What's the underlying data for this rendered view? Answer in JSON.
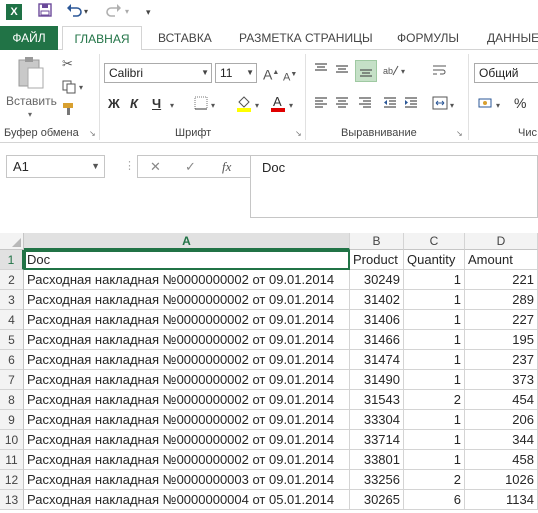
{
  "qat": {
    "logo": "X",
    "save_icon": "save-icon",
    "undo_icon": "undo-icon",
    "redo_icon": "redo-icon",
    "customize_icon": "customize-icon"
  },
  "tabs": [
    "ФАЙЛ",
    "ГЛАВНАЯ",
    "ВСТАВКА",
    "РАЗМЕТКА СТРАНИЦЫ",
    "ФОРМУЛЫ",
    "ДАННЫЕ"
  ],
  "ribbon": {
    "clipboard": {
      "paste_label": "Вставить",
      "group_label": "Буфер обмена"
    },
    "font": {
      "font_name": "Calibri",
      "font_size": "11",
      "bold": "Ж",
      "italic": "К",
      "underline": "Ч",
      "group_label": "Шрифт"
    },
    "alignment": {
      "group_label": "Выравнивание"
    },
    "number": {
      "format": "Общий",
      "percent": "%",
      "group_label": "Чис"
    }
  },
  "formula_bar": {
    "name_box": "A1",
    "cancel": "✕",
    "enter": "✓",
    "fx": "fx",
    "value": "Doc"
  },
  "grid": {
    "columns": [
      "A",
      "B",
      "C",
      "D"
    ],
    "rows": [
      [
        "Doc",
        "Product",
        "Quantity",
        "Amount"
      ],
      [
        "Расходная накладная №0000000002 от 09.01.2014",
        "30249",
        "1",
        "221"
      ],
      [
        "Расходная накладная №0000000002 от 09.01.2014",
        "31402",
        "1",
        "289"
      ],
      [
        "Расходная накладная №0000000002 от 09.01.2014",
        "31406",
        "1",
        "227"
      ],
      [
        "Расходная накладная №0000000002 от 09.01.2014",
        "31466",
        "1",
        "195"
      ],
      [
        "Расходная накладная №0000000002 от 09.01.2014",
        "31474",
        "1",
        "237"
      ],
      [
        "Расходная накладная №0000000002 от 09.01.2014",
        "31490",
        "1",
        "373"
      ],
      [
        "Расходная накладная №0000000002 от 09.01.2014",
        "31543",
        "2",
        "454"
      ],
      [
        "Расходная накладная №0000000002 от 09.01.2014",
        "33304",
        "1",
        "206"
      ],
      [
        "Расходная накладная №0000000002 от 09.01.2014",
        "33714",
        "1",
        "344"
      ],
      [
        "Расходная накладная №0000000002 от 09.01.2014",
        "33801",
        "1",
        "458"
      ],
      [
        "Расходная накладная №0000000003 от 09.01.2014",
        "33256",
        "2",
        "1026"
      ],
      [
        "Расходная накладная №0000000004 от 05.01.2014",
        "30265",
        "6",
        "1134"
      ]
    ]
  },
  "colors": {
    "accent": "#217346",
    "file_tab": "#217346"
  }
}
